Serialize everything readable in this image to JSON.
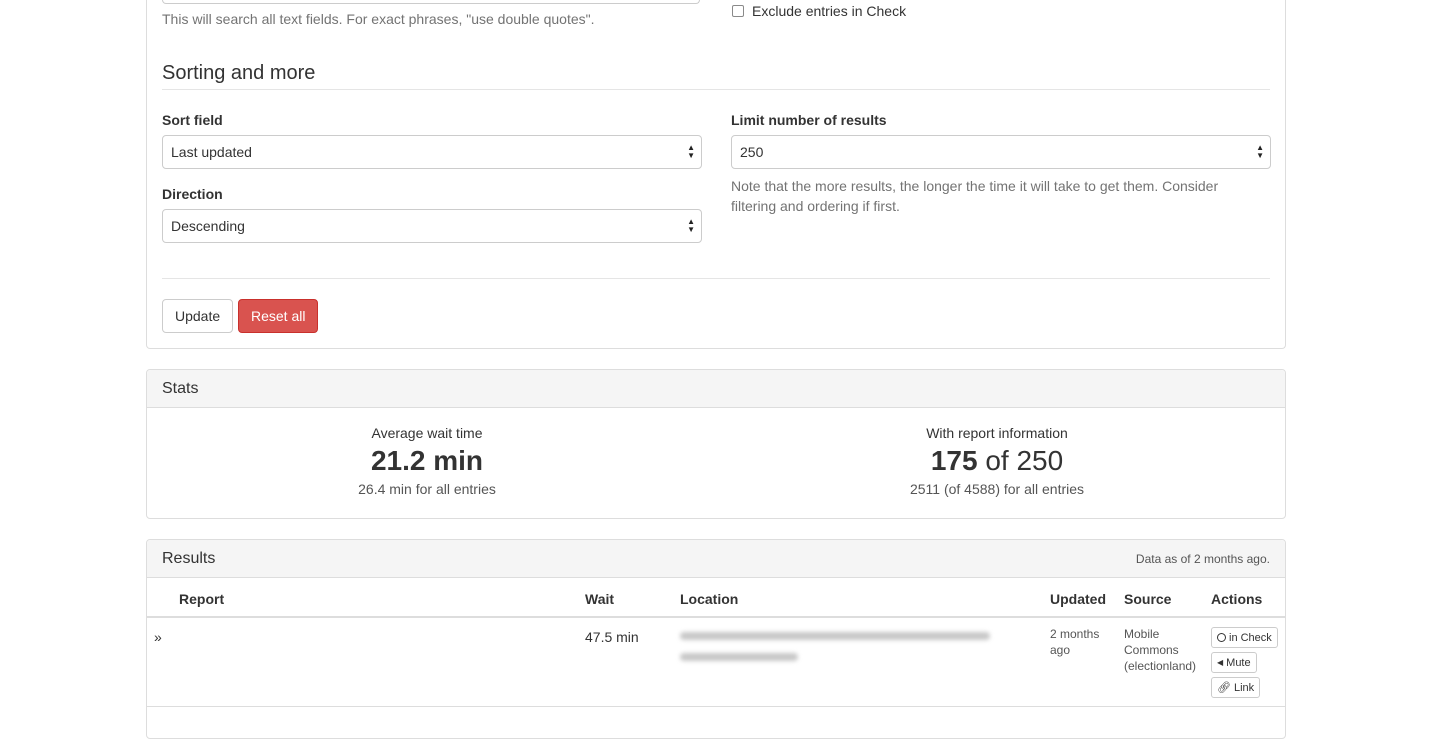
{
  "search": {
    "help_text": "This will search all text fields. For exact phrases, \"use double quotes\".",
    "exclude_label": "Exclude entries in Check"
  },
  "sorting": {
    "title": "Sorting and more",
    "sort_field_label": "Sort field",
    "sort_field_value": "Last updated",
    "direction_label": "Direction",
    "direction_value": "Descending",
    "limit_label": "Limit number of results",
    "limit_value": "250",
    "limit_note": "Note that the more results, the longer the time it will take to get them. Consider filtering and ordering if first."
  },
  "buttons": {
    "update": "Update",
    "reset": "Reset all"
  },
  "stats": {
    "title": "Stats",
    "avg_label": "Average wait time",
    "avg_value": "21.2 min",
    "avg_sub": "26.4 min for all entries",
    "report_label": "With report information",
    "report_count": "175",
    "report_of": "of 250",
    "report_sub": "2511 (of 4588) for all entries"
  },
  "results": {
    "title": "Results",
    "data_as_of": "Data as of 2 months ago.",
    "columns": [
      "Report",
      "Wait",
      "Location",
      "Updated",
      "Source",
      "Actions"
    ],
    "rows": [
      {
        "expand": "»",
        "wait": "47.5 min",
        "updated": "2 months ago",
        "source": "Mobile Commons (electionland)",
        "actions": [
          {
            "icon": "circle-icon",
            "label": "in Check"
          },
          {
            "icon": "speaker-icon",
            "label": "Mute"
          },
          {
            "icon": "link-icon",
            "label": "Link"
          }
        ]
      }
    ]
  }
}
